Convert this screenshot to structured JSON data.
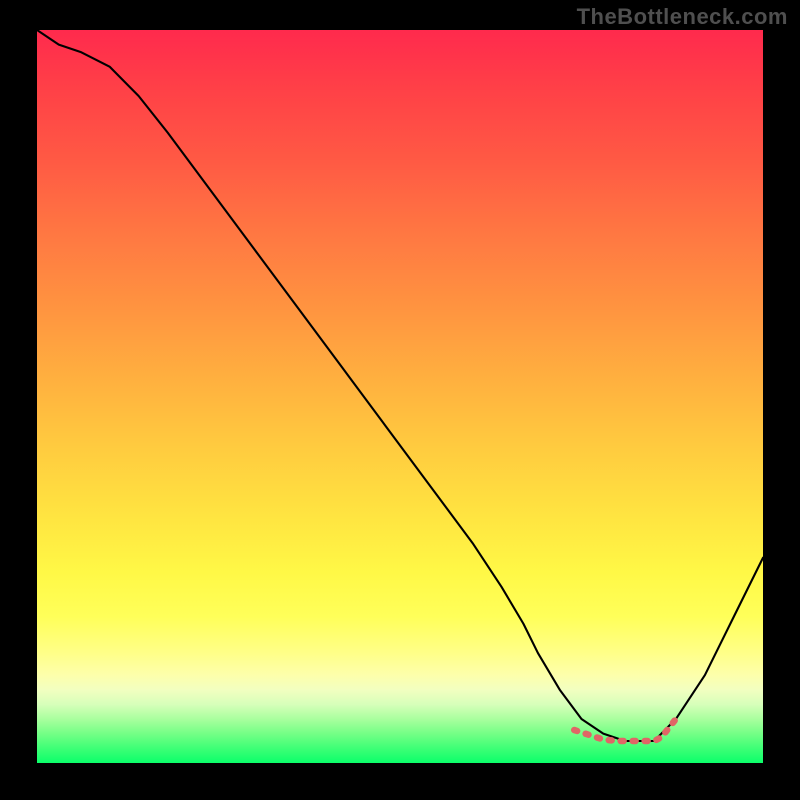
{
  "watermark": "TheBottleneck.com",
  "chart_data": {
    "type": "line",
    "title": "",
    "xlabel": "",
    "ylabel": "",
    "xlim": [
      0,
      100
    ],
    "ylim": [
      0,
      100
    ],
    "grid": false,
    "series": [
      {
        "name": "curve",
        "color": "#000000",
        "stroke_width": 2.1,
        "x": [
          0,
          3,
          6,
          10,
          14,
          18,
          24,
          30,
          36,
          42,
          48,
          54,
          60,
          64,
          67,
          69,
          72,
          75,
          78,
          81,
          83,
          85,
          88,
          92,
          96,
          100
        ],
        "y": [
          100,
          98,
          97,
          95,
          91,
          86,
          78,
          70,
          62,
          54,
          46,
          38,
          30,
          24,
          19,
          15,
          10,
          6,
          4,
          3,
          3,
          3,
          6,
          12,
          20,
          28
        ]
      },
      {
        "name": "highlight",
        "color": "#e06666",
        "stroke_width": 6.5,
        "x": [
          74,
          78,
          80,
          82,
          83,
          84,
          85,
          86,
          88
        ],
        "y": [
          4.5,
          3.2,
          3.0,
          3.0,
          3.0,
          3.0,
          3.0,
          3.5,
          6
        ]
      }
    ],
    "annotations": []
  }
}
